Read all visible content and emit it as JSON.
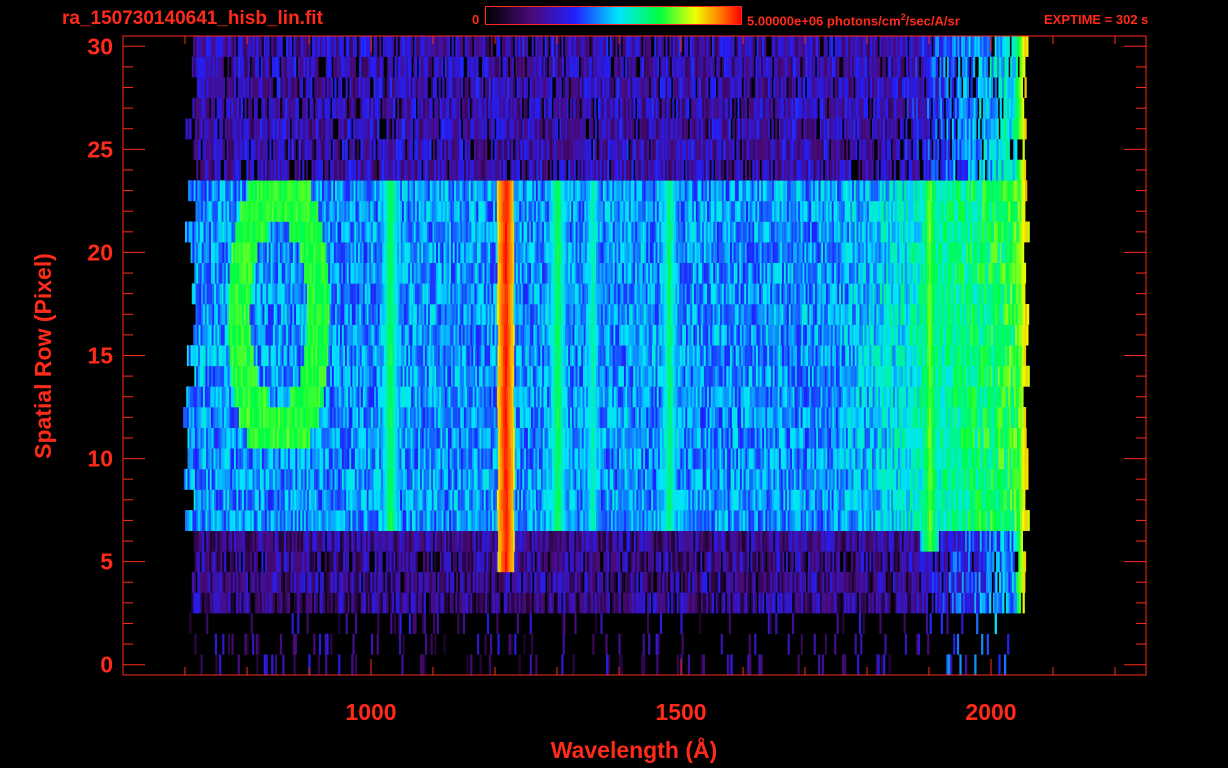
{
  "header": {
    "filename": "ra_150730140641_hisb_lin.fit",
    "colorbar_min_label": "0",
    "colorbar_max_label": "5.00000e+06 photons/cm",
    "colorbar_sup": "2",
    "colorbar_unit_tail": "/sec/A/sr",
    "exptime_label": "EXPTIME = 302 s"
  },
  "colors": {
    "axis": "#ff2a1a",
    "background": "#000000",
    "colormap": [
      "#000000",
      "#4a0a7a",
      "#2020ff",
      "#00e6ff",
      "#00ff40",
      "#f0ff00",
      "#ff7a00",
      "#ff0000"
    ]
  },
  "chart_data": {
    "type": "heatmap",
    "title": "ra_150730140641_hisb_lin.fit",
    "xlabel": "Wavelength (Å)",
    "ylabel": "Spatial Row (Pixel)",
    "xlim": [
      600,
      2250
    ],
    "ylim": [
      -0.5,
      30.5
    ],
    "x_ticks": [
      1000,
      1500,
      2000
    ],
    "y_ticks": [
      0,
      5,
      10,
      15,
      20,
      25,
      30
    ],
    "grid": false,
    "colorbar": {
      "min": 0,
      "max": 5000000,
      "unit": "photons/cm2/sec/A/sr",
      "position": "top"
    },
    "spectrum_extent_x": [
      700,
      2060
    ],
    "bright_band_rows": [
      7,
      23
    ],
    "features": [
      {
        "x": 1030,
        "rows": [
          7,
          23
        ],
        "level": 0.55
      },
      {
        "x": 1216,
        "rows": [
          5,
          23
        ],
        "level": 0.95
      },
      {
        "x": 1300,
        "rows": [
          7,
          23
        ],
        "level": 0.55
      },
      {
        "x": 1356,
        "rows": [
          7,
          23
        ],
        "level": 0.48
      },
      {
        "x": 1480,
        "rows": [
          7,
          23
        ],
        "level": 0.52
      },
      {
        "x": 1900,
        "rows": [
          6,
          23
        ],
        "level": 0.62
      },
      {
        "x": 2055,
        "rows": [
          1,
          30
        ],
        "level": 0.75
      }
    ],
    "ring_feature": {
      "x_range": [
        800,
        900
      ],
      "rows": [
        11,
        23
      ],
      "level": 0.55
    }
  }
}
